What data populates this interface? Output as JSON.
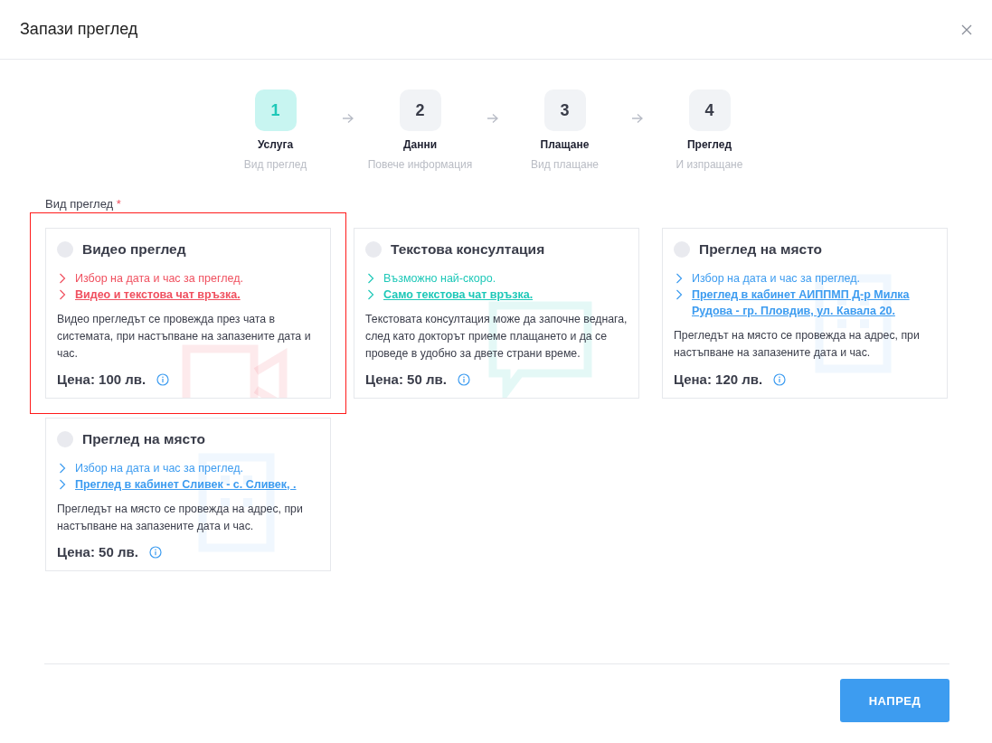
{
  "window": {
    "title": "Запази преглед"
  },
  "steps": [
    {
      "number": "1",
      "title": "Услуга",
      "subtitle": "Вид преглед",
      "selected": true
    },
    {
      "number": "2",
      "title": "Данни",
      "subtitle": "Повече информация",
      "selected": false
    },
    {
      "number": "3",
      "title": "Плащане",
      "subtitle": "Вид плащане",
      "selected": false
    },
    {
      "number": "4",
      "title": "Преглед",
      "subtitle": "И изпращане",
      "selected": false
    }
  ],
  "field": {
    "label": "Вид преглед",
    "required_mark": "*"
  },
  "options": [
    {
      "kind": "video",
      "title": "Видео преглед",
      "selected": false,
      "error": true,
      "color": "#f0505f",
      "features": [
        {
          "kind": "text",
          "text": "Избор на дата и час за преглед."
        },
        {
          "kind": "link",
          "text": "Видео и текстова чат връзка."
        }
      ],
      "description": "Видео прегледът се провежда през чата в системата, при настъпване на запазените дата и час.",
      "price": "Цена: 100 лв."
    },
    {
      "kind": "chat",
      "title": "Текстова консултация",
      "selected": false,
      "error": false,
      "color": "#1ec8b8",
      "features": [
        {
          "kind": "text",
          "text": "Възможно най-скоро."
        },
        {
          "kind": "link",
          "text": "Само текстова чат връзка."
        }
      ],
      "description": "Текстовата консултация може да започне веднага, след като докторът приеме плащането и да се проведе в удобно за двете страни време.",
      "price": "Цена: 50 лв."
    },
    {
      "kind": "building",
      "title": "Преглед на място",
      "selected": false,
      "error": false,
      "color": "#3d9cf0",
      "features": [
        {
          "kind": "text",
          "text": "Избор на дата и час за преглед."
        },
        {
          "kind": "link",
          "text": "Преглед в кабинет АИППМП Д-р Милка Рудова - гр. Пловдив, ул. Кавала 20."
        }
      ],
      "description": "Прегледът на място се провежда на адрес, при настъпване на запазените дата и час.",
      "price": "Цена: 120 лв."
    },
    {
      "kind": "building",
      "title": "Преглед на място",
      "selected": false,
      "error": false,
      "color": "#3d9cf0",
      "features": [
        {
          "kind": "text",
          "text": "Избор на дата и час за преглед."
        },
        {
          "kind": "link",
          "text": "Преглед в кабинет Сливек - с. Сливек, ."
        }
      ],
      "description": "Прегледът на място се провежда на адрес, при настъпване на запазените дата и час.",
      "price": "Цена: 50 лв."
    }
  ],
  "buttons": {
    "next": "НАПРЕД"
  }
}
